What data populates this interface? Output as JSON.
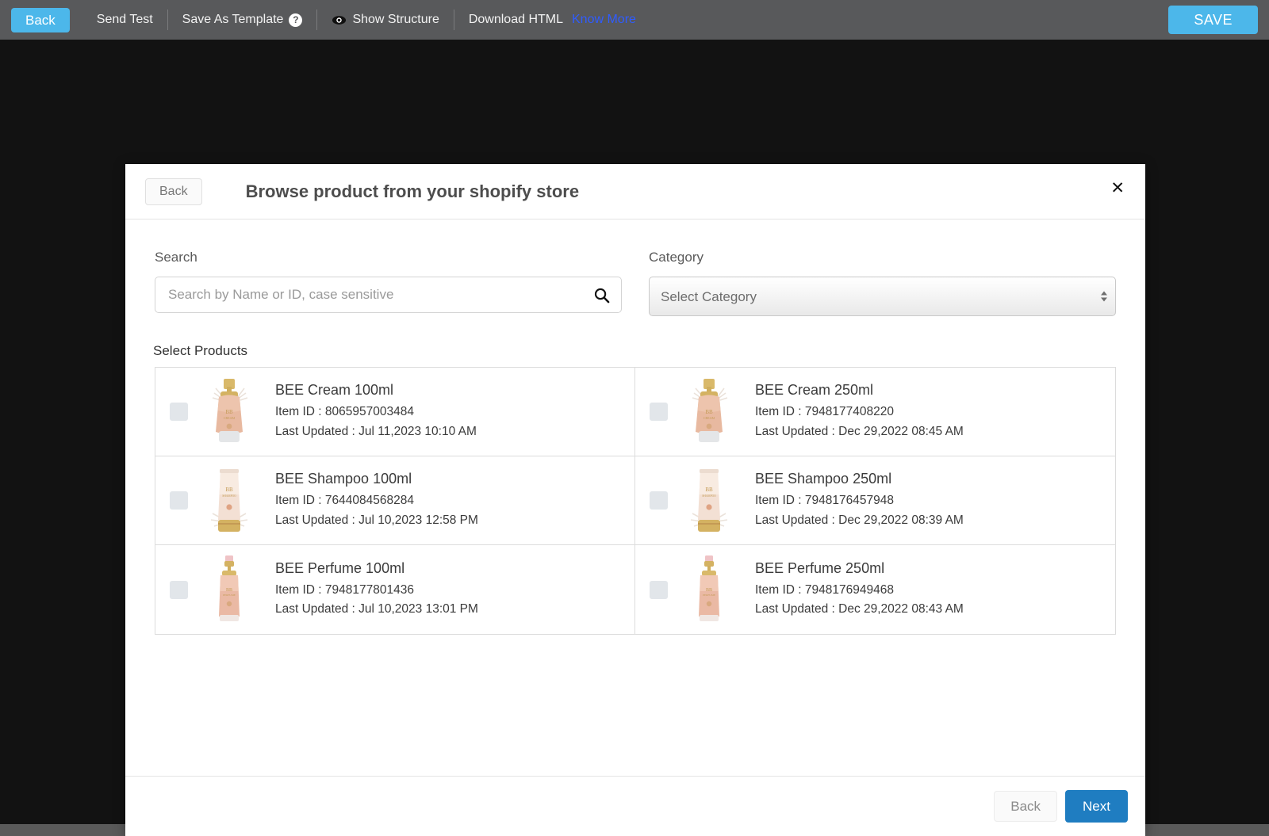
{
  "toolbar": {
    "back_label": "Back",
    "send_test_label": "Send Test",
    "save_as_template_label": "Save As Template",
    "help_glyph": "?",
    "show_structure_label": "Show Structure",
    "download_html_label": "Download HTML",
    "know_more_label": "Know More",
    "save_label": "SAVE",
    "accent_color": "#4cb7ea",
    "bar_color": "#58595b",
    "link_color": "#2f5cff"
  },
  "modal": {
    "back_label": "Back",
    "title": "Browse product from your shopify store",
    "close_glyph": "✕",
    "search": {
      "label": "Search",
      "placeholder": "Search by Name or ID, case sensitive",
      "value": "",
      "icon": "search-icon"
    },
    "category": {
      "label": "Category",
      "selected": "Select Category",
      "options": [
        "Select Category"
      ]
    },
    "products_label": "Select Products",
    "products": [
      {
        "name": "BEE Cream 100ml",
        "item_id": "Item ID : 8065957003484",
        "last_updated": "Last Updated : Jul 11,2023 10:10 AM",
        "thumb": "cream-bottle-image",
        "checked": false
      },
      {
        "name": "BEE Cream 250ml",
        "item_id": "Item ID : 7948177408220",
        "last_updated": "Last Updated : Dec 29,2022 08:45 AM",
        "thumb": "cream-bottle-image",
        "checked": false
      },
      {
        "name": "BEE Shampoo 100ml",
        "item_id": "Item ID : 7644084568284",
        "last_updated": "Last Updated : Jul 10,2023 12:58 PM",
        "thumb": "shampoo-tube-image",
        "checked": false
      },
      {
        "name": "BEE Shampoo 250ml",
        "item_id": "Item ID : 7948176457948",
        "last_updated": "Last Updated : Dec 29,2022 08:39 AM",
        "thumb": "shampoo-tube-image",
        "checked": false
      },
      {
        "name": "BEE Perfume 100ml",
        "item_id": "Item ID : 7948177801436",
        "last_updated": "Last Updated : Jul 10,2023 13:01 PM",
        "thumb": "perfume-bottle-image",
        "checked": false
      },
      {
        "name": "BEE Perfume 250ml",
        "item_id": "Item ID : 7948176949468",
        "last_updated": "Last Updated : Dec 29,2022 08:43 AM",
        "thumb": "perfume-bottle-image",
        "checked": false
      }
    ],
    "footer": {
      "back_label": "Back",
      "next_label": "Next",
      "next_color": "#1f7dc1"
    }
  }
}
